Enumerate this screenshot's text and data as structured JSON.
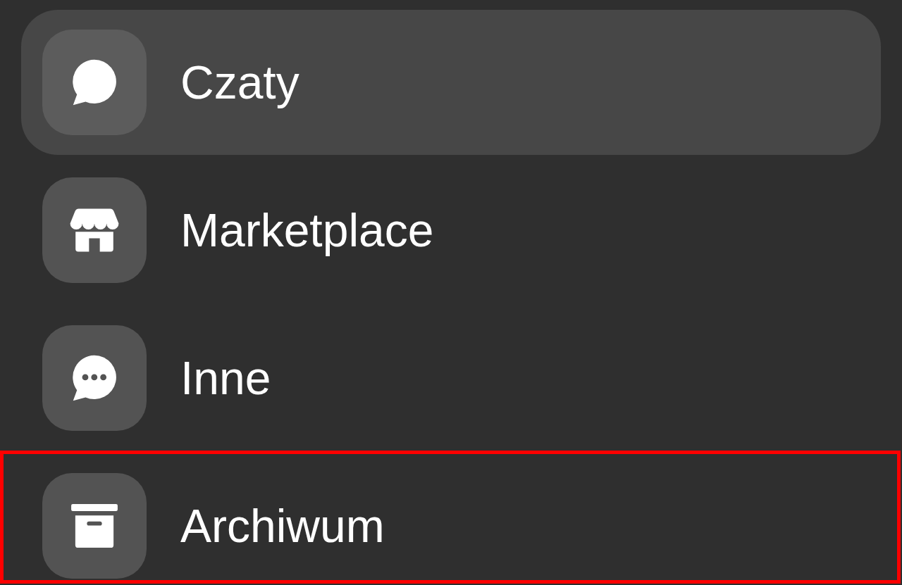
{
  "items": [
    {
      "label": "Czaty",
      "selected": true,
      "highlighted": false
    },
    {
      "label": "Marketplace",
      "selected": false,
      "highlighted": false
    },
    {
      "label": "Inne",
      "selected": false,
      "highlighted": false
    },
    {
      "label": "Archiwum",
      "selected": false,
      "highlighted": true
    }
  ]
}
